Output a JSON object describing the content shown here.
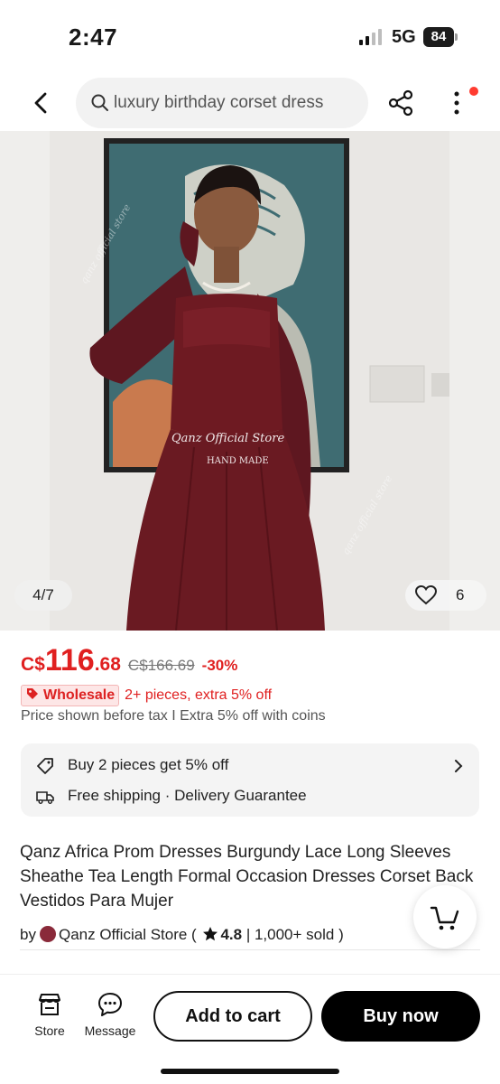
{
  "status_bar": {
    "time": "2:47",
    "network": "5G",
    "battery": "84"
  },
  "search": {
    "query": "luxury birthday corset dress"
  },
  "gallery": {
    "counter": "4/7",
    "likes": "6",
    "watermark_store": "Qanz Official Store",
    "watermark_tag": "HAND MADE",
    "watermark_diag": "qanz official store"
  },
  "price": {
    "currency": "C$",
    "integer": "116",
    "decimal": ".68",
    "original": "C$166.69",
    "discount": "-30%"
  },
  "wholesale": {
    "badge": "Wholesale",
    "text": "2+ pieces, extra 5% off"
  },
  "tax_note": "Price shown before tax I Extra 5% off with coins",
  "promo": {
    "offer": "Buy 2 pieces get 5% off",
    "shipping": "Free shipping · Delivery Guarantee"
  },
  "product": {
    "title": "Qanz Africa Prom Dresses Burgundy Lace Long Sleeves Sheathe Tea Length Formal Occasion Dresses Corset Back Vestidos Para Mujer",
    "by": "by",
    "store": "Qanz Official Store (",
    "rating": "4.8",
    "sold": "| 1,000+ sold )"
  },
  "bottom_bar": {
    "store_label": "Store",
    "message_label": "Message",
    "add_to_cart": "Add to cart",
    "buy_now": "Buy now"
  },
  "colors": {
    "accent": "#e02020",
    "primary_button": "#000000",
    "dress": "#6e1a22"
  }
}
